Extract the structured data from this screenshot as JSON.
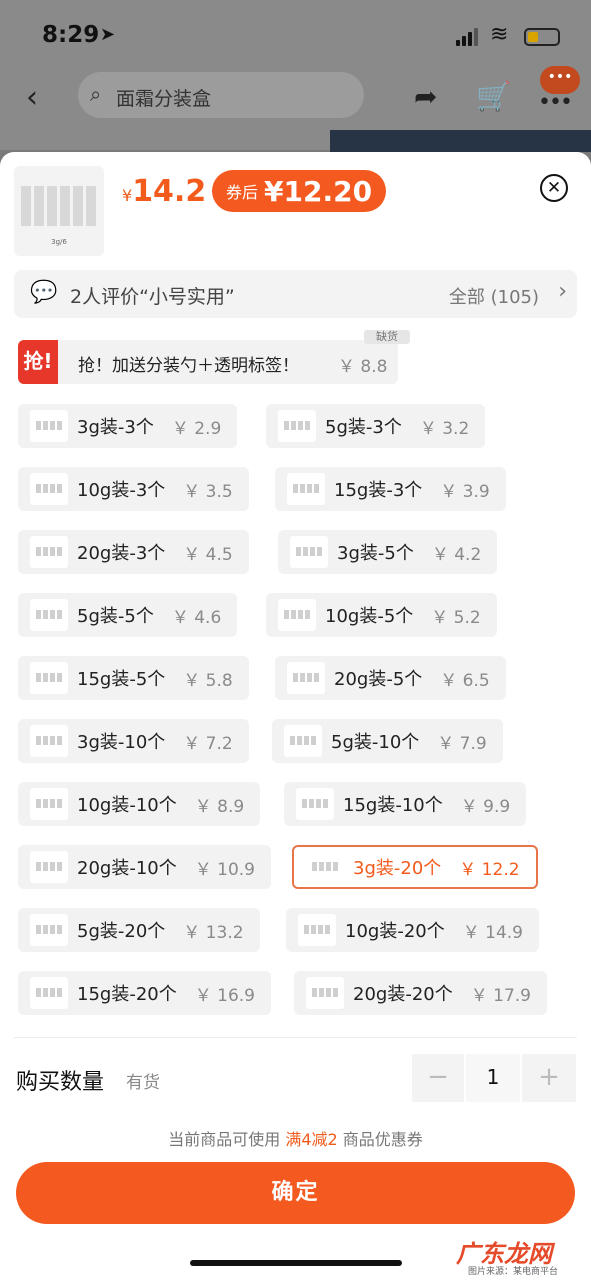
{
  "status_bar": {
    "time": "8:29",
    "location_glyph": "➤"
  },
  "nav": {
    "search_placeholder": "面霜分装盒",
    "badge": "•••"
  },
  "product": {
    "thumb_label": "3g/6",
    "currency": "¥",
    "price": "14.2",
    "coupon_label": "券后",
    "coupon_price": "¥12.20"
  },
  "reviews": {
    "text": "2人评价“小号实用”",
    "all": "全部 (105)"
  },
  "promo": {
    "badge": "抢!",
    "label": "抢！加送分装勺＋透明标签！",
    "price": "￥ 8.8",
    "tag": "缺货"
  },
  "options": [
    {
      "label": "3g装-3个",
      "price": "￥ 2.9"
    },
    {
      "label": "5g装-3个",
      "price": "￥ 3.2"
    },
    {
      "label": "10g装-3个",
      "price": "￥ 3.5"
    },
    {
      "label": "15g装-3个",
      "price": "￥ 3.9"
    },
    {
      "label": "20g装-3个",
      "price": "￥ 4.5"
    },
    {
      "label": "3g装-5个",
      "price": "￥ 4.2"
    },
    {
      "label": "5g装-5个",
      "price": "￥ 4.6"
    },
    {
      "label": "10g装-5个",
      "price": "￥ 5.2"
    },
    {
      "label": "15g装-5个",
      "price": "￥ 5.8"
    },
    {
      "label": "20g装-5个",
      "price": "￥ 6.5"
    },
    {
      "label": "3g装-10个",
      "price": "￥ 7.2"
    },
    {
      "label": "5g装-10个",
      "price": "￥ 7.9"
    },
    {
      "label": "10g装-10个",
      "price": "￥ 8.9"
    },
    {
      "label": "15g装-10个",
      "price": "￥ 9.9"
    },
    {
      "label": "20g装-10个",
      "price": "￥ 10.9"
    },
    {
      "label": "3g装-20个",
      "price": "￥ 12.2",
      "selected": true
    },
    {
      "label": "5g装-20个",
      "price": "￥ 13.2"
    },
    {
      "label": "10g装-20个",
      "price": "￥ 14.9"
    },
    {
      "label": "15g装-20个",
      "price": "￥ 16.9"
    },
    {
      "label": "20g装-20个",
      "price": "￥ 17.9"
    }
  ],
  "quantity": {
    "label": "购买数量",
    "stock": "有货",
    "minus": "−",
    "value": "1",
    "plus": "+"
  },
  "coupon_info": {
    "prefix": "当前商品可使用",
    "highlight": "满4减2",
    "suffix": "商品优惠券"
  },
  "confirm_label": "确定",
  "watermark": {
    "main": "广东龙网",
    "sub": "图片来源：某电商平台"
  },
  "accent_color": "#f45a20"
}
